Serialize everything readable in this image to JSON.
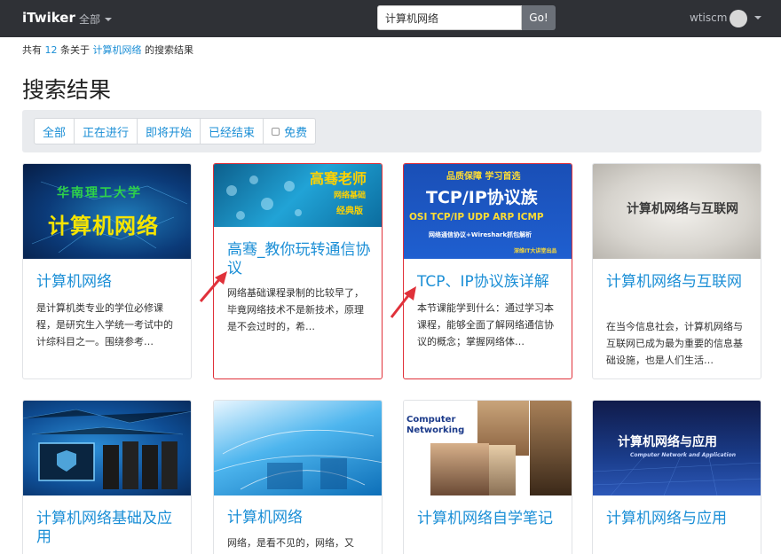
{
  "navbar": {
    "brand": "iTwiker",
    "category": "全部",
    "search_value": "计算机网络",
    "search_button": "Go!",
    "username": "wtiscm"
  },
  "summary": {
    "prefix": "共有",
    "count": "12",
    "middle": "条关于",
    "keyword": "计算机网络",
    "suffix": "的搜索结果"
  },
  "page_title": "搜索结果",
  "filters": [
    "全部",
    "正在进行",
    "即将开始",
    "已经结束",
    "免费"
  ],
  "cards": [
    {
      "title": "计算机网络",
      "desc": "是计算机类专业的学位必修课程，是研究生入学统一考试中的计综科目之一。围绕参考…",
      "thumb_lines": [
        "华南理工大学",
        "计算机网络"
      ]
    },
    {
      "title": "高骞_教你玩转通信协议",
      "desc": "网络基础课程录制的比较早了，毕竟网络技术不是新技术，原理是不会过时的，希…",
      "thumb_lines": [
        "高骞老师",
        "网络基础",
        "经典版"
      ]
    },
    {
      "title": "TCP、IP协议族详解",
      "desc": "本节课能学到什么：通过学习本课程，能够全面了解网络通信协议的概念；掌握网络体…",
      "thumb_lines": [
        "品质保障 学习首选",
        "TCP/IP协议族",
        "OSI TCP/IP UDP ARP ICMP",
        "网络通信协议+Wireshark抓包解析",
        "深维IT大讲堂出品"
      ]
    },
    {
      "title": "计算机网络与互联网",
      "desc": "在当今信息社会，计算机网络与互联网已成为最为重要的信息基础设施，也是人们生活…",
      "thumb_lines": [
        "计算机网络与互联网"
      ]
    },
    {
      "title": "计算机网络基础及应用",
      "desc": "",
      "thumb_lines": []
    },
    {
      "title": "计算机网络",
      "desc": "网络，是看不见的，网络，又",
      "thumb_lines": []
    },
    {
      "title": "计算机网络自学笔记",
      "desc": "",
      "thumb_lines": [
        "Computer",
        "Networking"
      ]
    },
    {
      "title": "计算机网络与应用",
      "desc": "",
      "thumb_lines": [
        "计算机网络与应用",
        "Computer Network and Application"
      ]
    }
  ],
  "colors": {
    "navbar_bg": "#2f3136",
    "link": "#1c8fd6",
    "highlight_border": "#e0313a",
    "arrow": "#e0313a"
  }
}
